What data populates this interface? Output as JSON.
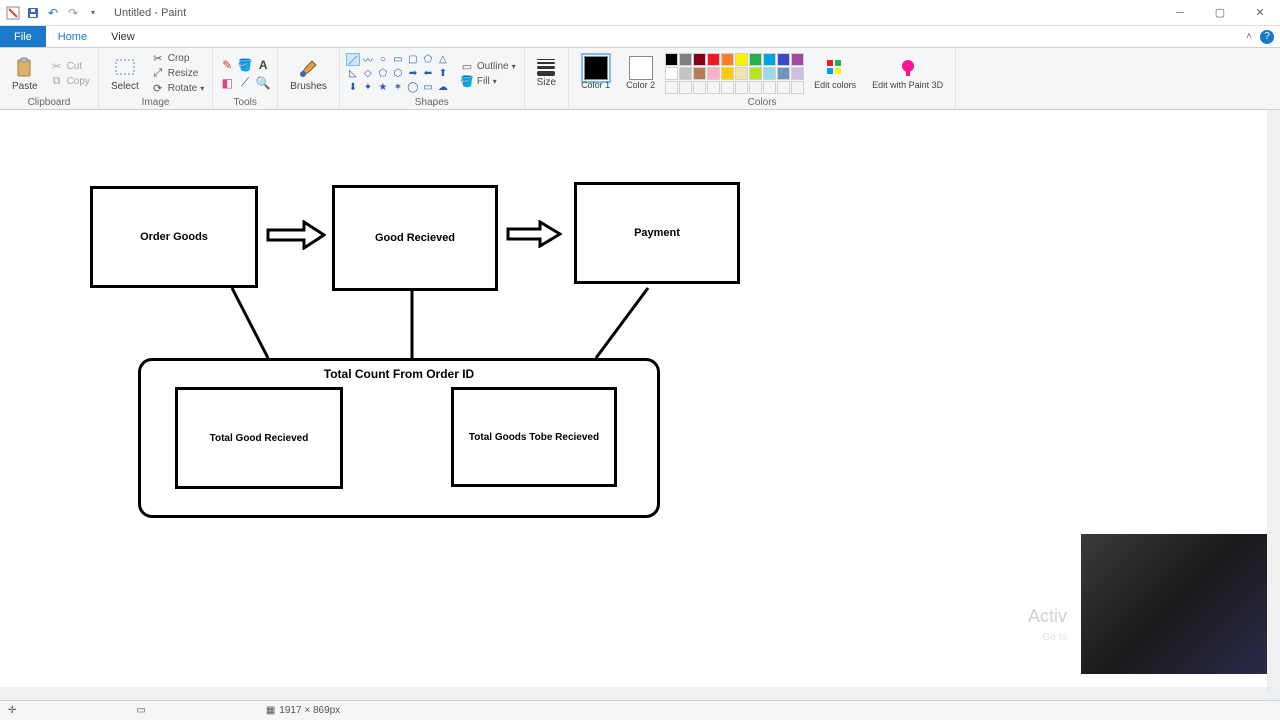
{
  "title": "Untitled - Paint",
  "tabs": {
    "file": "File",
    "home": "Home",
    "view": "View"
  },
  "ribbon": {
    "clipboard": {
      "label": "Clipboard",
      "paste": "Paste",
      "cut": "Cut",
      "copy": "Copy"
    },
    "image": {
      "label": "Image",
      "select": "Select",
      "crop": "Crop",
      "resize": "Resize",
      "rotate": "Rotate"
    },
    "tools": {
      "label": "Tools"
    },
    "brushes": {
      "label": "Brushes"
    },
    "shapes": {
      "label": "Shapes",
      "outline": "Outline",
      "fill": "Fill"
    },
    "size": {
      "label": "Size"
    },
    "colors": {
      "label": "Colors",
      "color1": "Color 1",
      "color2": "Color 2",
      "edit": "Edit colors",
      "edit3d": "Edit with Paint 3D",
      "color1_value": "#000000",
      "color2_value": "#ffffff",
      "palette_row1": [
        "#000000",
        "#7f7f7f",
        "#880015",
        "#ed1c24",
        "#ff7f27",
        "#fff200",
        "#22b14c",
        "#00a2e8",
        "#3f48cc",
        "#a349a4"
      ],
      "palette_row2": [
        "#ffffff",
        "#c3c3c3",
        "#b97a57",
        "#ffaec9",
        "#ffc90e",
        "#efe4b0",
        "#b5e61d",
        "#99d9ea",
        "#7092be",
        "#c8bfe7"
      ],
      "palette_row3": [
        "#f5f5f5",
        "#f5f5f5",
        "#f5f5f5",
        "#f5f5f5",
        "#f5f5f5",
        "#f5f5f5",
        "#f5f5f5",
        "#f5f5f5",
        "#f5f5f5",
        "#f5f5f5"
      ]
    }
  },
  "diagram": {
    "box1": "Order Goods",
    "box2": "Good Recieved",
    "box3": "Payment",
    "container_title": "Total Count From Order ID",
    "inner1": "Total Good Recieved",
    "inner2": "Total Goods Tobe Recieved"
  },
  "status": {
    "dimensions": "1917 × 869px"
  },
  "watermark": {
    "line1": "Activ",
    "line2": "Go to"
  }
}
